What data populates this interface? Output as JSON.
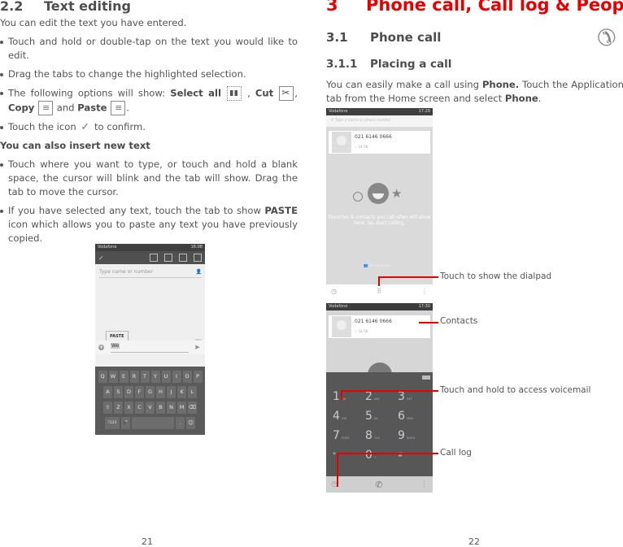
{
  "left_page": {
    "section_number": "2.2",
    "section_title": "Text editing",
    "intro": "You can edit the text you have entered.",
    "bullets": {
      "b1": "Touch and hold or double-tap on the text you would like to edit.",
      "b2": "Drag the tabs to change the highlighted selection.",
      "b3_prefix": "The following options will show: ",
      "b3_select_all": "Select all",
      "b3_comma1": " , ",
      "b3_cut": "Cut",
      "b3_comma2": ", ",
      "b3_copy": "Copy",
      "b3_and": " and ",
      "b3_paste": "Paste",
      "b3_end": ".",
      "b4_prefix": "Touch the icon ",
      "b4_suffix": " to confirm."
    },
    "subheading": "You can also insert new text",
    "bullets2": {
      "b1": "Touch where you want to type, or touch and hold a blank space, the cursor will blink and the tab will show. Drag the tab to move the cursor.",
      "b2_prefix": "If you have selected any text, touch the tab to show ",
      "b2_bold": "PASTE",
      "b2_suffix": " icon which allows you to paste any text you have previously copied."
    },
    "screenshot": {
      "carrier": "Vodafone",
      "time": "16:08",
      "to_placeholder": "Type name or number",
      "paste_label": "PASTE",
      "typed_text": "We",
      "char_count": "159/1",
      "keyboard_rows": [
        [
          "Q",
          "W",
          "E",
          "R",
          "T",
          "Y",
          "U",
          "I",
          "O",
          "P"
        ],
        [
          "A",
          "S",
          "D",
          "F",
          "G",
          "H",
          "J",
          "K",
          "L"
        ],
        [
          "⇧",
          "Z",
          "X",
          "C",
          "V",
          "B",
          "N",
          "M",
          "⌫"
        ],
        [
          "?123",
          "🎤",
          " ",
          ".",
          "☺"
        ]
      ]
    },
    "page_number": "21"
  },
  "right_page": {
    "chapter_number": "3",
    "chapter_title": "Phone call, Call log & People",
    "section_number": "3.1",
    "section_title": "Phone call",
    "subsection_number": "3.1.1",
    "subsection_title": "Placing a call",
    "body_part1": "You can easily make a call using ",
    "body_bold1": "Phone.",
    "body_part2": " Touch the Application tab from the Home screen and select ",
    "body_bold2": "Phone",
    "body_end": ".",
    "screenshot1": {
      "carrier": "Vodafone",
      "time": "17:29",
      "search_placeholder": "Type a name or phone number",
      "contact_number": "021 6146 0666",
      "call_duration": "14:58",
      "favorites_text": "Favorites & contacts you call often will show here. So, start calling.",
      "all_contacts": "All contacts"
    },
    "screenshot2": {
      "carrier": "Vodafone",
      "time": "17:30",
      "contact_number": "021 6146 0666",
      "call_duration": "14:58",
      "dialpad": [
        {
          "d": "1",
          "l": "QD"
        },
        {
          "d": "2",
          "l": "ABC"
        },
        {
          "d": "3",
          "l": "DEF"
        },
        {
          "d": "4",
          "l": "GHI"
        },
        {
          "d": "5",
          "l": "JKL"
        },
        {
          "d": "6",
          "l": "MNO"
        },
        {
          "d": "7",
          "l": "PQRS"
        },
        {
          "d": "8",
          "l": "TUV"
        },
        {
          "d": "9",
          "l": "WXYZ"
        },
        {
          "d": "*",
          "l": ""
        },
        {
          "d": "0",
          "l": "+"
        },
        {
          "d": "#",
          "l": ""
        }
      ]
    },
    "callouts": {
      "dialpad": "Touch to show the dialpad",
      "contacts": "Contacts",
      "voicemail": "Touch and hold to access voicemail",
      "call_log": "Call log"
    },
    "accent_color": "#e60000",
    "page_number": "22"
  }
}
